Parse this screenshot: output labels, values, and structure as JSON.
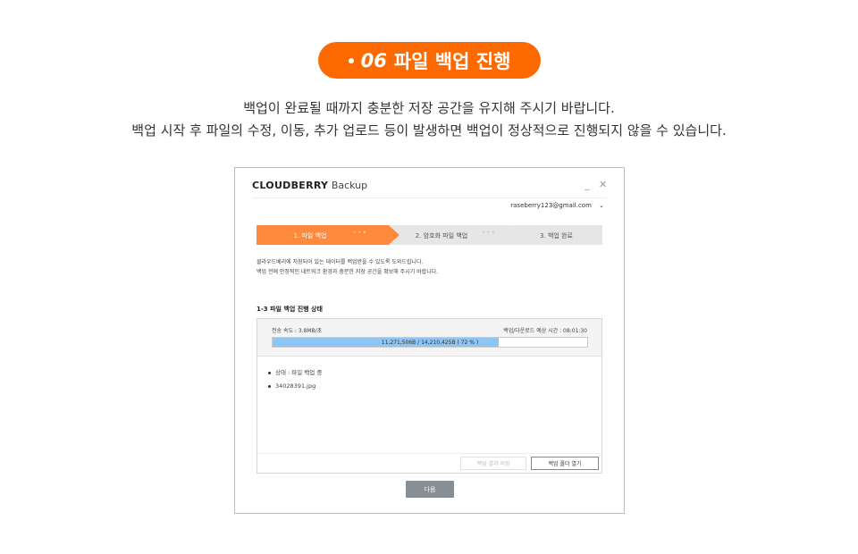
{
  "header": {
    "step_number": "06",
    "title": "파일 백업 진행",
    "accent_color": "#ff6a00"
  },
  "description": {
    "line1": "백업이 완료될 때까지 충분한 저장 공간을 유지해 주시기 바랍니다.",
    "line2": "백업 시작 후 파일의 수정, 이동, 추가 업로드 등이 발생하면 백업이 정상적으로 진행되지 않을 수 있습니다."
  },
  "app": {
    "brand_bold": "CLOUDBERRY",
    "brand_light": "Backup",
    "minimize_icon": "_",
    "close_icon": "✕",
    "account": "raseberry123@gmail.com",
    "steps": [
      {
        "label": "1. 파일 백업",
        "state": "active"
      },
      {
        "label": "2. 암호화 파일 백업",
        "state": "inactive"
      },
      {
        "label": "3. 백업 완료",
        "state": "inactive"
      }
    ],
    "info_line1": "클라우드베리에 저장되어 있는 데이터를 백업받을 수 있도록 도와드립니다.",
    "info_line2": "백업 전에 안정적인 네트워크 환경과 충분한 저장 공간을 확보해 주시기 바랍니다.",
    "section_title": "1-3  파일 백업 진행 상태",
    "transfer_speed": "전송 속도 : 3.8MB/초",
    "eta": "백업/다운로드 예상 시간 : 08:01:30",
    "progress": {
      "text": "11,271,506B / 14,210,425B ( 72 % )",
      "percent": 72,
      "color": "#8ec5f5"
    },
    "status_items": [
      "상태 : 파일 백업 중",
      "34028391.jpg"
    ],
    "save_result_button": "백업 결과 저장",
    "open_folder_button": "백업 폴더 열기",
    "next_button": "다음"
  }
}
